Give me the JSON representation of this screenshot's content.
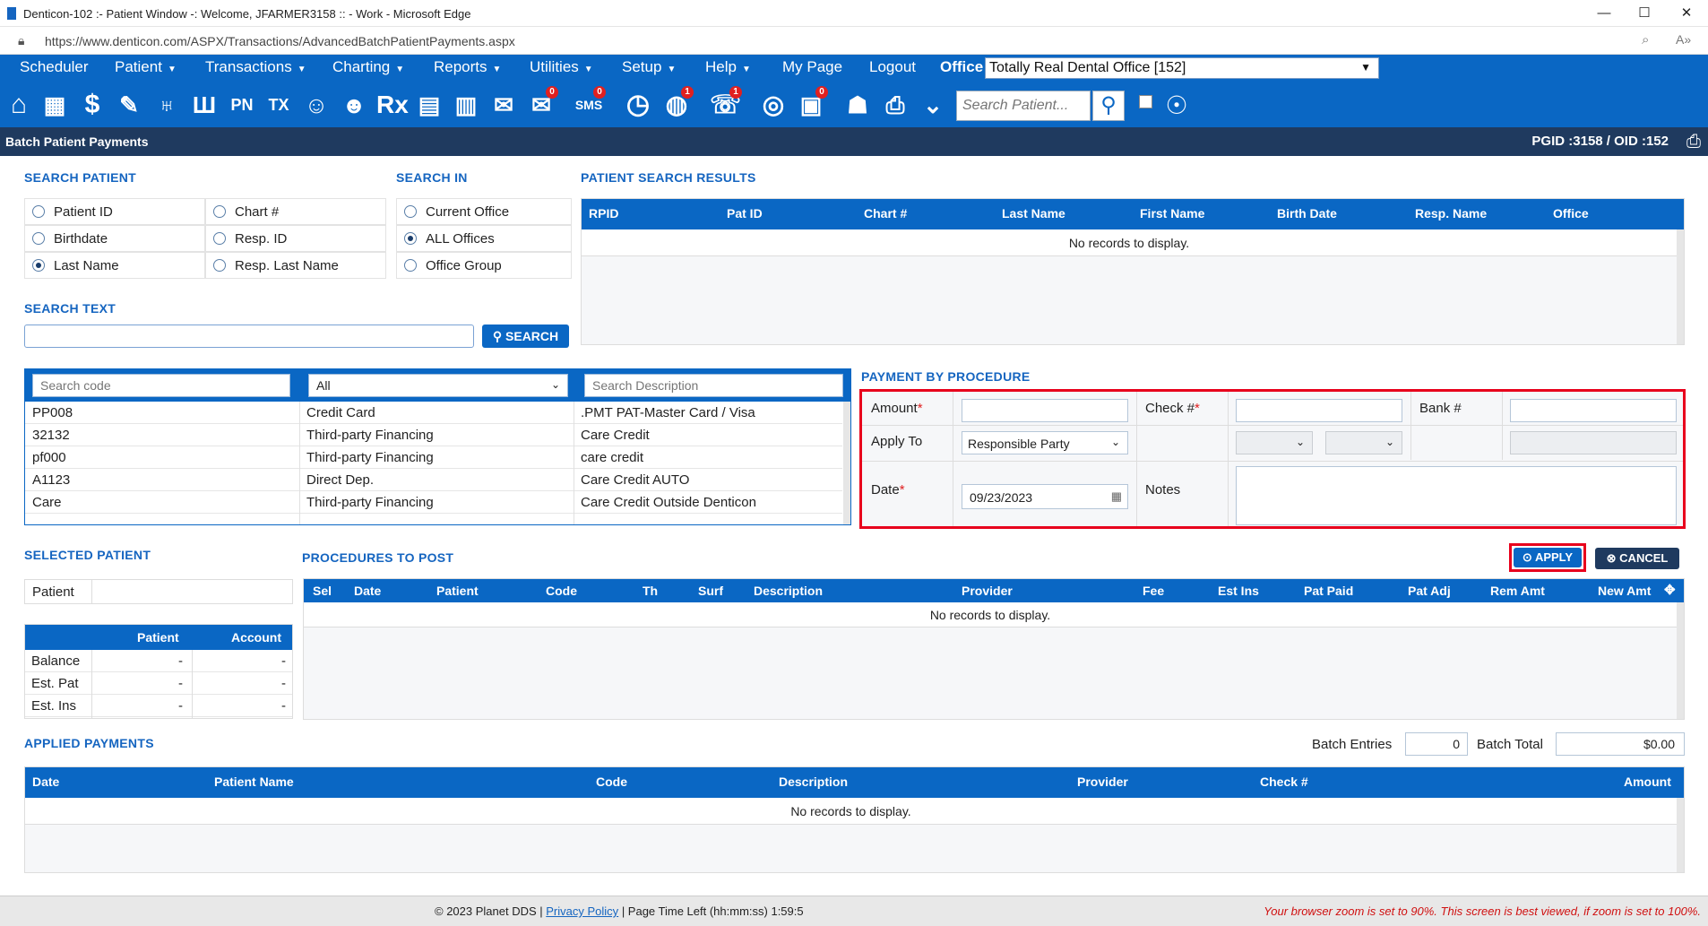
{
  "window": {
    "title": "Denticon-102 :- Patient Window -: Welcome, JFARMER3158 :: - Work - Microsoft Edge",
    "url": "https://www.denticon.com/ASPX/Transactions/AdvancedBatchPatientPayments.aspx"
  },
  "nav": {
    "items": [
      "Scheduler",
      "Patient",
      "Transactions",
      "Charting",
      "Reports",
      "Utilities",
      "Setup",
      "Help",
      "My Page",
      "Logout"
    ],
    "office_label": "Office",
    "office_value": "Totally Real Dental Office [152]"
  },
  "toolbar": {
    "search_placeholder": "Search Patient...",
    "icons": [
      "home-icon",
      "calendar-icon",
      "dollar-icon",
      "edit-icon",
      "tooth-icon",
      "tooth-root-icon",
      "pn-icon",
      "tx-icon",
      "add-patient-icon",
      "add-family-icon",
      "rx-icon",
      "notes-icon",
      "print-doc-icon",
      "email-icon",
      "message-icon",
      "sms-icon",
      "clock-icon",
      "globe-alert-icon",
      "support-icon",
      "network-icon",
      "form-icon",
      "family-icon",
      "printer-icon",
      "expand-icon"
    ],
    "pn": "PN",
    "tx": "TX",
    "rx": "Rx",
    "sms": "SMS",
    "badges": {
      "message": "0",
      "sms": "0",
      "globe": "1",
      "support": "1",
      "form": "0"
    }
  },
  "page": {
    "title": "Batch Patient Payments",
    "ids": "PGID :3158  /  OID :152"
  },
  "search_patient": {
    "label": "SEARCH PATIENT",
    "options": [
      {
        "label": "Patient ID",
        "checked": false
      },
      {
        "label": "Chart #",
        "checked": false
      },
      {
        "label": "Birthdate",
        "checked": false
      },
      {
        "label": "Resp. ID",
        "checked": false
      },
      {
        "label": "Last Name",
        "checked": true
      },
      {
        "label": "Resp. Last Name",
        "checked": false
      }
    ]
  },
  "search_in": {
    "label": "SEARCH IN",
    "options": [
      {
        "label": "Current Office",
        "checked": false
      },
      {
        "label": "ALL Offices",
        "checked": true
      },
      {
        "label": "Office Group",
        "checked": false
      }
    ]
  },
  "search_text": {
    "label": "SEARCH TEXT",
    "value": "",
    "button": "SEARCH"
  },
  "results": {
    "label": "PATIENT SEARCH RESULTS",
    "columns": [
      "RPID",
      "Pat ID",
      "Chart #",
      "Last Name",
      "First Name",
      "Birth Date",
      "Resp. Name",
      "Office"
    ],
    "empty": "No records to display."
  },
  "codes": {
    "code_placeholder": "Search code",
    "type_value": "All",
    "desc_placeholder": "Search Description",
    "rows": [
      {
        "code": "PP008",
        "type": "Credit Card",
        "desc": ".PMT PAT-Master Card / Visa"
      },
      {
        "code": "32132",
        "type": "Third-party Financing",
        "desc": "Care Credit"
      },
      {
        "code": "pf000",
        "type": "Third-party Financing",
        "desc": "care credit"
      },
      {
        "code": "A1123",
        "type": "Direct Dep.",
        "desc": "Care Credit AUTO"
      },
      {
        "code": "Care",
        "type": "Third-party Financing",
        "desc": "Care Credit Outside Denticon"
      }
    ]
  },
  "payment": {
    "label": "PAYMENT BY PROCEDURE",
    "amount_label": "Amount",
    "check_label": "Check #",
    "bank_label": "Bank #",
    "apply_to_label": "Apply To",
    "apply_to_value": "Responsible Party",
    "date_label": "Date",
    "date_value": "09/23/2023",
    "notes_label": "Notes",
    "required_mark": "*"
  },
  "actions": {
    "apply": "APPLY",
    "cancel": "CANCEL"
  },
  "selected_patient": {
    "label": "SELECTED PATIENT",
    "patient_label": "Patient",
    "col_patient": "Patient",
    "col_account": "Account",
    "rows": [
      {
        "label": "Balance",
        "patient": "-",
        "account": "-"
      },
      {
        "label": "Est. Pat",
        "patient": "-",
        "account": "-"
      },
      {
        "label": "Est. Ins",
        "patient": "-",
        "account": "-"
      }
    ]
  },
  "procedures": {
    "label": "PROCEDURES TO POST",
    "columns": [
      "Sel",
      "Date",
      "Patient",
      "Code",
      "Th",
      "Surf",
      "Description",
      "Provider",
      "Fee",
      "Est Ins",
      "Pat Paid",
      "Pat Adj",
      "Rem Amt",
      "New Amt"
    ],
    "empty": "No records to display."
  },
  "applied": {
    "label": "APPLIED PAYMENTS",
    "batch_entries_label": "Batch Entries",
    "batch_entries": "0",
    "batch_total_label": "Batch Total",
    "batch_total": "$0.00",
    "columns": [
      "Date",
      "Patient Name",
      "Code",
      "Description",
      "Provider",
      "Check #",
      "Amount"
    ],
    "empty": "No records to display."
  },
  "footer": {
    "copyright": "© 2023 Planet DDS |",
    "privacy": "Privacy Policy",
    "time_left": "| Page Time Left (hh:mm:ss) 1:59:5",
    "zoom_warning": "Your browser zoom is set to 90%. This screen is best viewed, if zoom is set to 100%."
  },
  "colors": {
    "primary": "#0a67c4",
    "header_dark": "#1f3a5f",
    "highlight": "#e8001c"
  }
}
